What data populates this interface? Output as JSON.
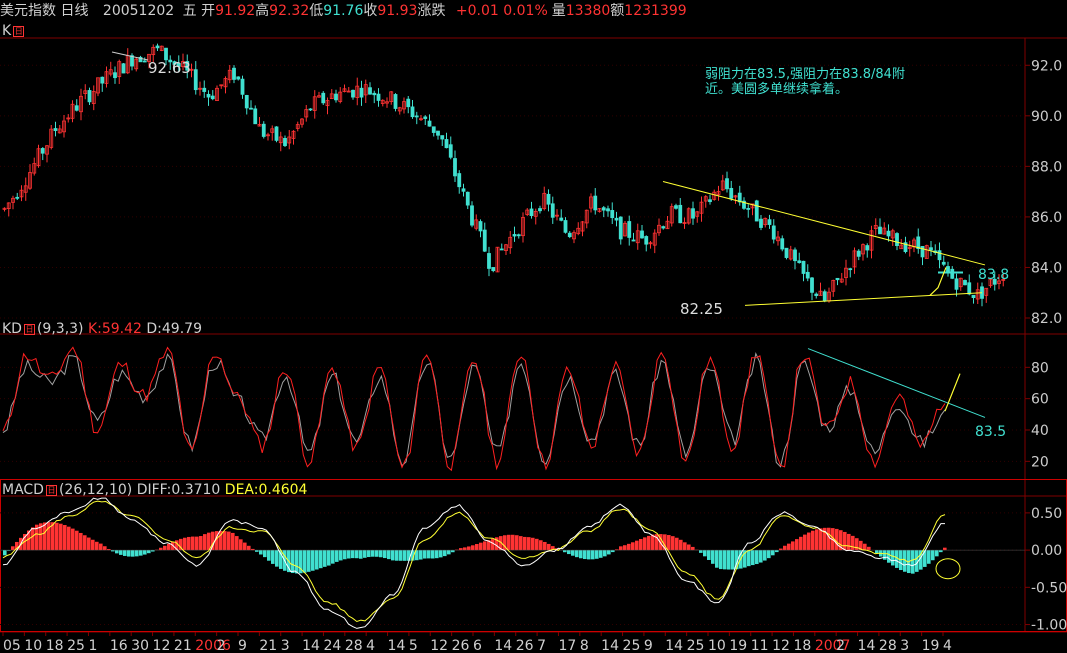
{
  "header": {
    "title": "美元指数 日线",
    "date": "20051202",
    "weekday": "五",
    "open_label": "开",
    "open": "91.92",
    "high_label": "高",
    "high": "92.32",
    "low_label": "低",
    "low": "91.76",
    "close_label": "收",
    "close": "91.93",
    "change_label": "涨跌",
    "change": "+0.01",
    "change_pct": "0.01%",
    "volume_label": "量",
    "volume": "13380",
    "amount_label": "额",
    "amount": "1231399"
  },
  "kline": {
    "label": "K",
    "high_marker": "92.63",
    "low_marker": "82.25",
    "annotation": "弱阻力在83.5,强阻力在83.8/84附\n近。美圆多单继续拿着。",
    "resistance_label": "83.8",
    "ticks": [
      "92.0",
      "90.0",
      "88.0",
      "86.0",
      "84.0",
      "82.0"
    ]
  },
  "kd": {
    "label": "KD",
    "params": "(9,3,3)",
    "k_text": "K:59.42",
    "d_text": "D:49.79",
    "line_label": "83.5",
    "ticks": [
      "80",
      "60",
      "40",
      "20"
    ]
  },
  "macd": {
    "label": "MACD",
    "params": "(26,12,10)",
    "diff_text": "DIFF:0.3710",
    "dea_text": "DEA:0.4604",
    "ticks": [
      "0.50",
      "0.00",
      "-0.50",
      "-1.00"
    ]
  },
  "x_axis_ticks": [
    "05",
    "10",
    "18",
    "25",
    "1",
    "16",
    "30",
    "12",
    "21",
    "2006",
    "2",
    "9",
    "21",
    "3",
    "14",
    "24",
    "28",
    "4",
    "14",
    "5",
    "12",
    "26",
    "6",
    "14",
    "26",
    "7",
    "17",
    "8",
    "14",
    "25",
    "9",
    "14",
    "25",
    "10",
    "19",
    "11",
    "12",
    "18",
    "2007",
    "2",
    "14",
    "28",
    "3",
    "19",
    "4"
  ],
  "chart_data": {
    "type": "line",
    "title": "美元指数 日线",
    "series": [
      {
        "name": "K",
        "values": [
          86.3,
          87.8,
          89.5,
          90.6,
          91.5,
          92.3,
          92.6,
          91.8,
          90.8,
          91.7,
          89.4,
          88.9,
          90.4,
          90.9,
          91.1,
          90.7,
          90.1,
          89.3,
          86.6,
          84.1,
          85.5,
          86.7,
          85.3,
          86.6,
          85.5,
          85.1,
          86.1,
          86.0,
          87.3,
          86.4,
          85.5,
          83.9,
          82.6,
          84.2,
          85.4,
          85.0,
          84.7,
          83.6,
          82.9,
          83.8
        ]
      },
      {
        "name": "KD-K",
        "values": [
          38,
          88,
          72,
          92,
          40,
          82,
          62,
          90,
          25,
          90,
          60,
          30,
          80,
          20,
          80,
          28,
          80,
          15,
          90,
          18,
          85,
          20,
          90,
          18,
          78,
          30,
          80,
          25,
          90,
          20,
          85,
          30,
          90,
          15,
          88,
          40,
          70,
          20,
          62,
          30,
          59.42
        ]
      },
      {
        "name": "KD-D",
        "values": [
          40,
          80,
          70,
          85,
          45,
          76,
          62,
          84,
          30,
          84,
          58,
          34,
          75,
          25,
          74,
          32,
          74,
          20,
          84,
          22,
          80,
          25,
          84,
          22,
          74,
          34,
          75,
          30,
          84,
          25,
          80,
          34,
          84,
          20,
          82,
          42,
          66,
          25,
          58,
          32,
          49.79
        ]
      },
      {
        "name": "MACD-DIFF",
        "values": [
          -0.2,
          0.3,
          0.5,
          0.7,
          0.4,
          0.1,
          -0.2,
          0.4,
          0.3,
          -0.3,
          -0.8,
          -1.05,
          -0.6,
          0.3,
          0.6,
          0.1,
          -0.2,
          0.0,
          0.3,
          0.6,
          0.2,
          -0.4,
          -0.7,
          0.1,
          0.5,
          0.3,
          0.0,
          -0.1,
          -0.2,
          0.37
        ]
      },
      {
        "name": "MACD-DEA",
        "values": [
          -0.1,
          0.2,
          0.45,
          0.65,
          0.45,
          0.15,
          -0.1,
          0.3,
          0.25,
          -0.2,
          -0.7,
          -0.95,
          -0.65,
          0.15,
          0.5,
          0.15,
          -0.1,
          0.0,
          0.25,
          0.55,
          0.25,
          -0.3,
          -0.65,
          0.0,
          0.45,
          0.3,
          0.05,
          -0.05,
          -0.15,
          0.4604
        ]
      }
    ],
    "panes": [
      {
        "name": "K",
        "ylim": [
          82.0,
          93.0
        ]
      },
      {
        "name": "KD",
        "ylim": [
          10,
          100
        ]
      },
      {
        "name": "MACD",
        "ylim": [
          -1.1,
          0.7
        ]
      }
    ]
  },
  "colors": {
    "up": "#ff3333",
    "down": "#40e0d0",
    "grid": "#800000",
    "trend": "#ffff33",
    "kline": "#b0b0b0"
  }
}
